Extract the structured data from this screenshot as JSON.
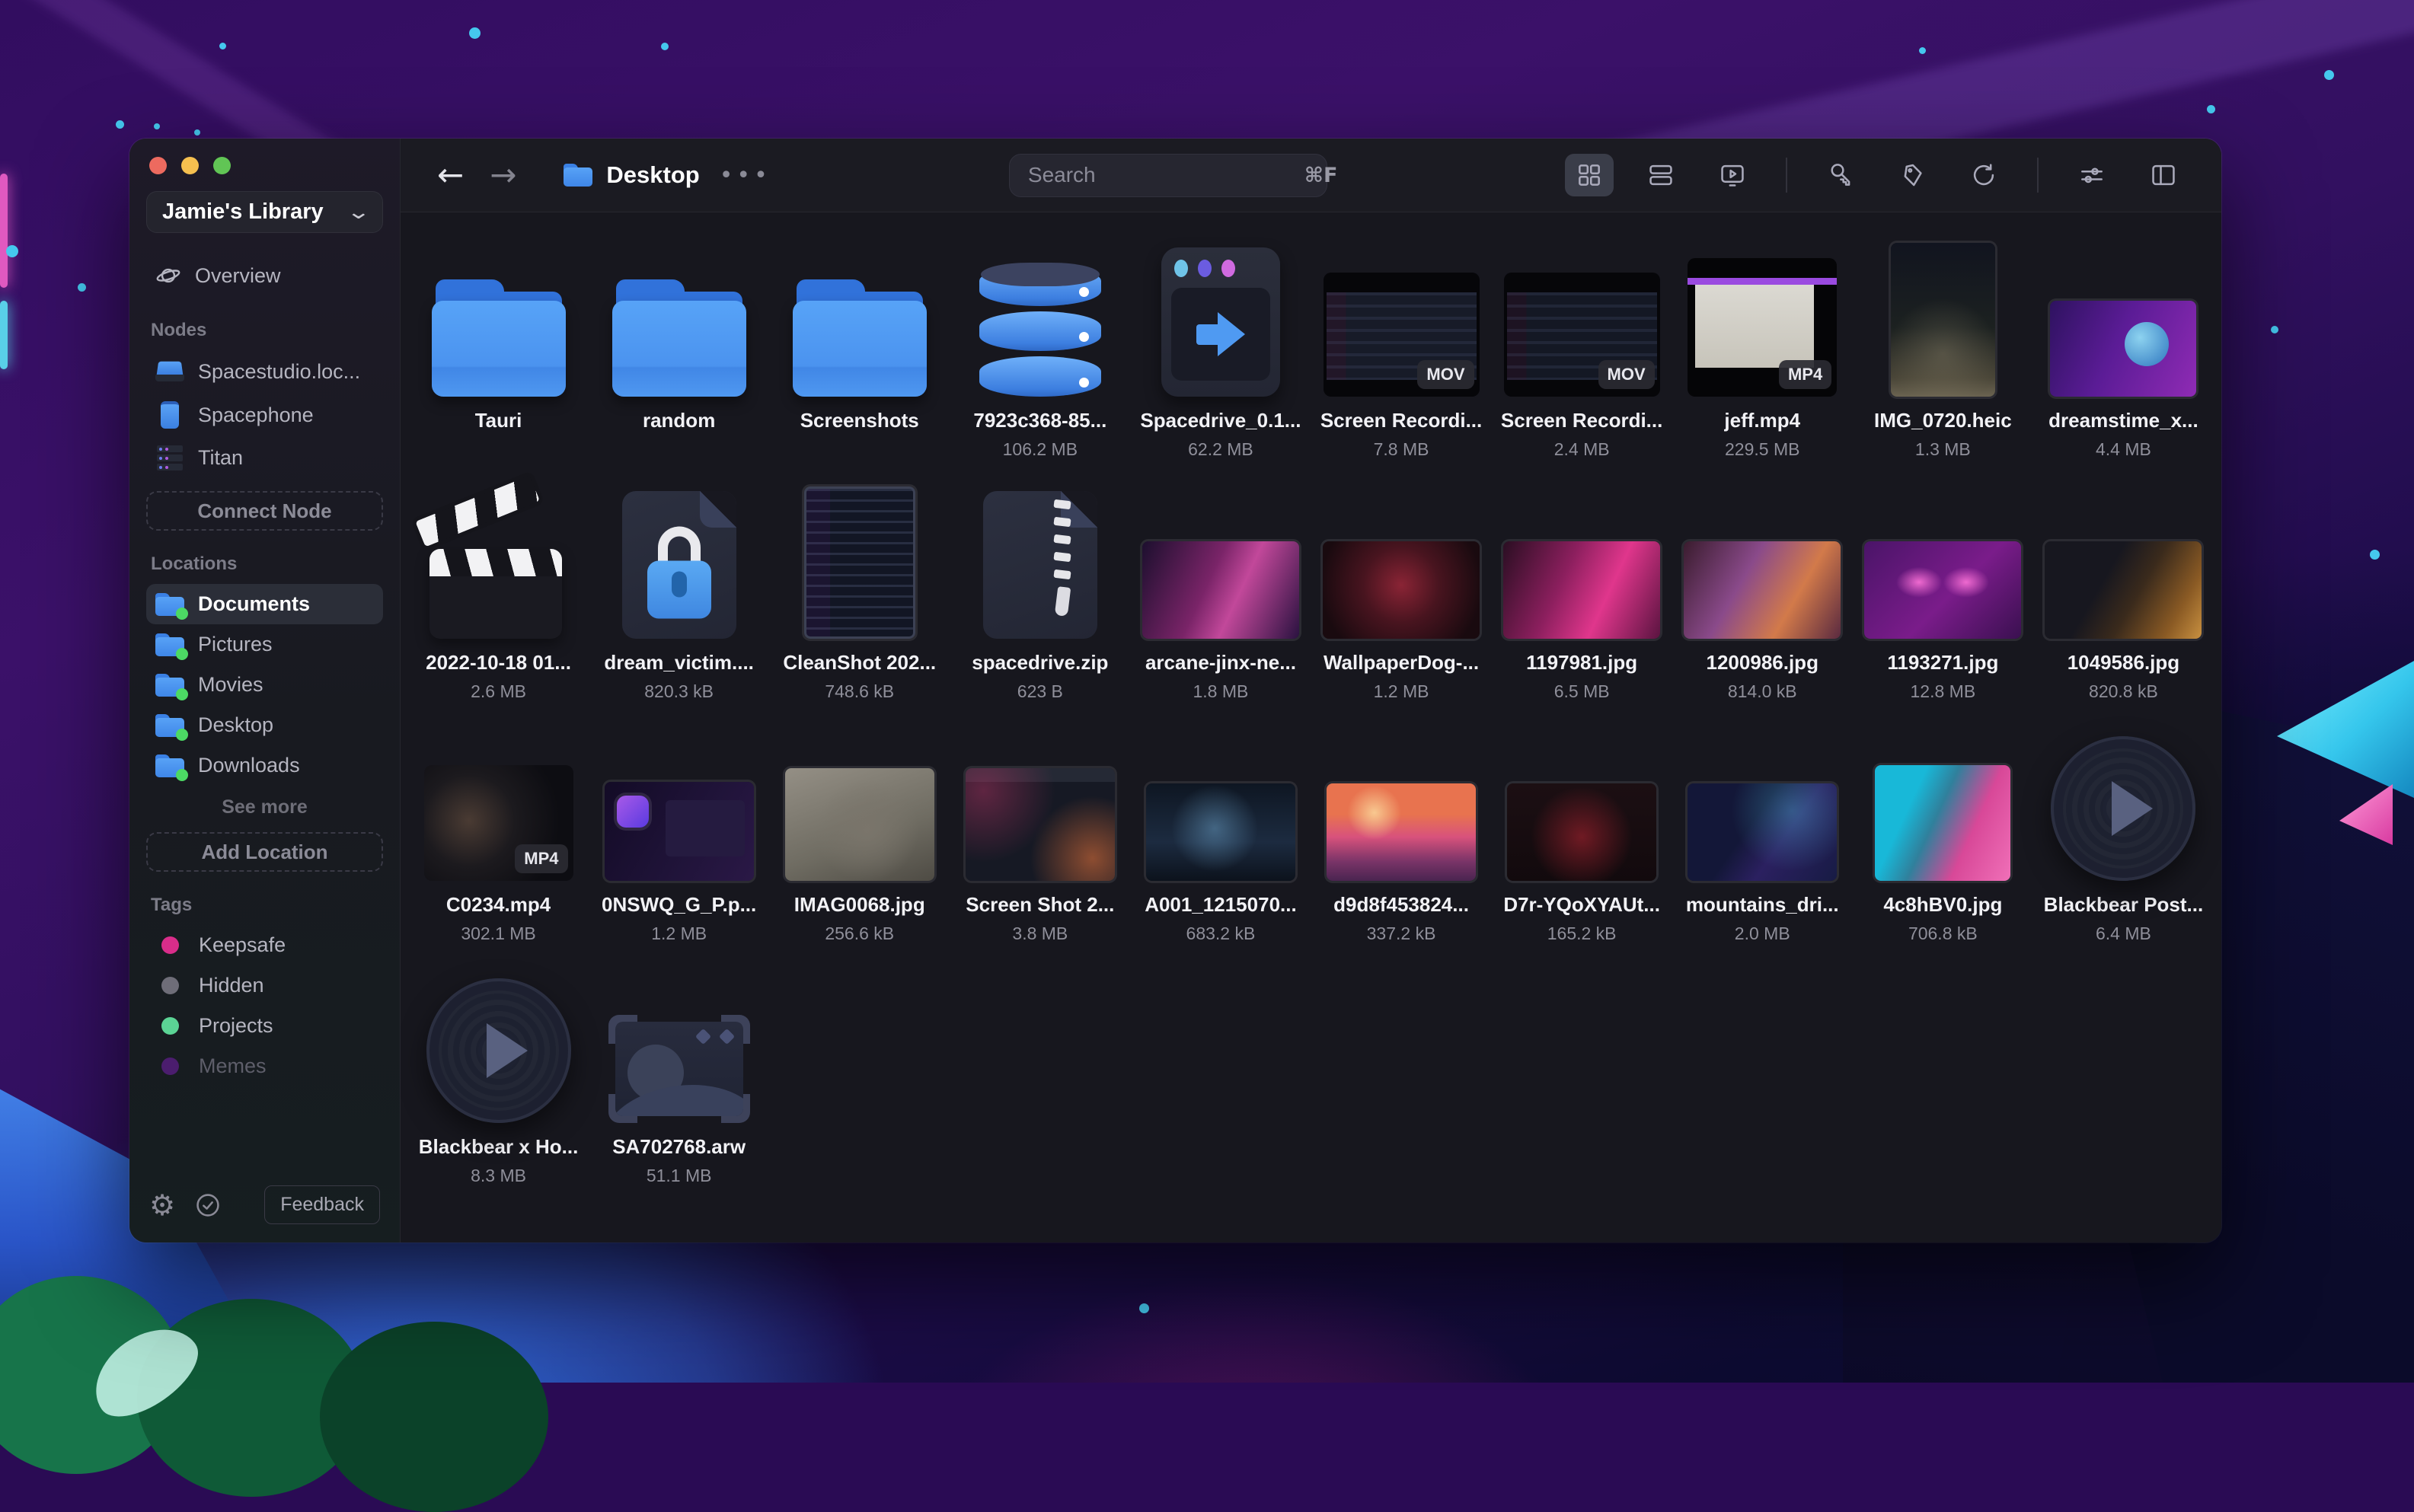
{
  "window": {
    "traffic_lights": [
      "close",
      "minimize",
      "zoom"
    ]
  },
  "sidebar": {
    "library": {
      "name": "Jamie's Library"
    },
    "overview": {
      "label": "Overview"
    },
    "nodes": {
      "heading": "Nodes",
      "items": [
        {
          "label": "Spacestudio.loc...",
          "icon": "laptop"
        },
        {
          "label": "Spacephone",
          "icon": "phone"
        },
        {
          "label": "Titan",
          "icon": "server"
        }
      ],
      "connect_button": "Connect Node"
    },
    "locations": {
      "heading": "Locations",
      "items": [
        {
          "label": "Documents",
          "selected": true
        },
        {
          "label": "Pictures",
          "selected": false
        },
        {
          "label": "Movies",
          "selected": false
        },
        {
          "label": "Desktop",
          "selected": false
        },
        {
          "label": "Downloads",
          "selected": false
        }
      ],
      "see_more": "See more",
      "add_button": "Add Location"
    },
    "tags": {
      "heading": "Tags",
      "items": [
        {
          "label": "Keepsafe",
          "color": "#d92d8a",
          "muted": false
        },
        {
          "label": "Hidden",
          "color": "#6e6d78",
          "muted": false
        },
        {
          "label": "Projects",
          "color": "#5bd495",
          "muted": false
        },
        {
          "label": "Memes",
          "color": "#4b1d6e",
          "muted": true
        }
      ]
    },
    "footer": {
      "feedback_label": "Feedback"
    }
  },
  "topbar": {
    "current_folder": "Desktop",
    "search": {
      "placeholder": "Search",
      "shortcut": "⌘F"
    }
  },
  "accent_color": "#4f9af2",
  "grid": {
    "items": [
      {
        "name": "Tauri",
        "size": "",
        "thumb": "folder",
        "badge": ""
      },
      {
        "name": "random",
        "size": "",
        "thumb": "folder",
        "badge": ""
      },
      {
        "name": "Screenshots",
        "size": "",
        "thumb": "folder",
        "badge": ""
      },
      {
        "name": "7923c368-85...",
        "size": "106.2 MB",
        "thumb": "database",
        "badge": ""
      },
      {
        "name": "Spacedrive_0.1...",
        "size": "62.2 MB",
        "thumb": "installer",
        "badge": ""
      },
      {
        "name": "Screen Recordi...",
        "size": "7.8 MB",
        "thumb": "screenrec",
        "badge": "MOV"
      },
      {
        "name": "Screen Recordi...",
        "size": "2.4 MB",
        "thumb": "screenrec2",
        "badge": "MOV"
      },
      {
        "name": "jeff.mp4",
        "size": "229.5 MB",
        "thumb": "jeff",
        "badge": "MP4"
      },
      {
        "name": "IMG_0720.heic",
        "size": "1.3 MB",
        "thumb": "night-photo",
        "badge": ""
      },
      {
        "name": "dreamstime_x...",
        "size": "4.4 MB",
        "thumb": "space-art",
        "badge": ""
      },
      {
        "name": "2022-10-18 01...",
        "size": "2.6 MB",
        "thumb": "clapper",
        "badge": ""
      },
      {
        "name": "dream_victim....",
        "size": "820.3 kB",
        "thumb": "lock-file",
        "badge": ""
      },
      {
        "name": "CleanShot 202...",
        "size": "748.6 kB",
        "thumb": "cleanshot",
        "badge": ""
      },
      {
        "name": "spacedrive.zip",
        "size": "623 B",
        "thumb": "zip-file",
        "badge": ""
      },
      {
        "name": "arcane-jinx-ne...",
        "size": "1.8 MB",
        "thumb": "art-jinx",
        "badge": ""
      },
      {
        "name": "WallpaperDog-...",
        "size": "1.2 MB",
        "thumb": "art-wings",
        "badge": ""
      },
      {
        "name": "1197981.jpg",
        "size": "6.5 MB",
        "thumb": "art-pink",
        "badge": ""
      },
      {
        "name": "1200986.jpg",
        "size": "814.0 kB",
        "thumb": "art-jinx2",
        "badge": ""
      },
      {
        "name": "1193271.jpg",
        "size": "12.8 MB",
        "thumb": "art-eyes",
        "badge": ""
      },
      {
        "name": "1049586.jpg",
        "size": "820.8 kB",
        "thumb": "art-orange",
        "badge": ""
      },
      {
        "name": "C0234.mp4",
        "size": "302.1 MB",
        "thumb": "c0234",
        "badge": "MP4"
      },
      {
        "name": "0NSWQ_G_P.p...",
        "size": "1.2 MB",
        "thumb": "app-shot",
        "badge": ""
      },
      {
        "name": "IMAG0068.jpg",
        "size": "256.6 kB",
        "thumb": "sepia",
        "badge": ""
      },
      {
        "name": "Screen Shot 2...",
        "size": "3.8 MB",
        "thumb": "shot-ui",
        "badge": ""
      },
      {
        "name": "A001_1215070...",
        "size": "683.2 kB",
        "thumb": "desk-photo",
        "badge": ""
      },
      {
        "name": "d9d8f453824...",
        "size": "337.2 kB",
        "thumb": "sunset",
        "badge": ""
      },
      {
        "name": "D7r-YQoXYAUt...",
        "size": "165.2 kB",
        "thumb": "dark-red",
        "badge": ""
      },
      {
        "name": "mountains_dri...",
        "size": "2.0 MB",
        "thumb": "poly",
        "badge": ""
      },
      {
        "name": "4c8hBV0.jpg",
        "size": "706.8 kB",
        "thumb": "vr-art",
        "badge": ""
      },
      {
        "name": "Blackbear Post...",
        "size": "6.4 MB",
        "thumb": "disc",
        "badge": ""
      },
      {
        "name": "Blackbear x Ho...",
        "size": "8.3 MB",
        "thumb": "disc",
        "badge": ""
      },
      {
        "name": "SA702768.arw",
        "size": "51.1 MB",
        "thumb": "raw",
        "badge": ""
      }
    ]
  }
}
